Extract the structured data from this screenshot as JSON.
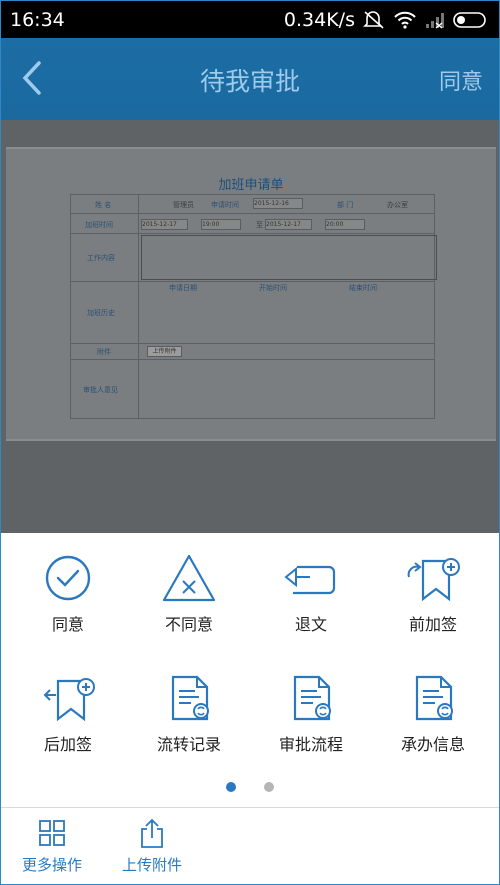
{
  "status": {
    "time": "16:34",
    "speed": "0.34K/s"
  },
  "appbar": {
    "title": "待我审批",
    "right_action": "同意"
  },
  "form": {
    "title": "加班申请单",
    "name_label": "姓 名",
    "name_value": "管理员",
    "apply_time_label": "申请时间",
    "apply_time_value": "2015-12-16",
    "dept_label": "部 门",
    "dept_value": "办公室",
    "overtime_label": "加班时间",
    "start_date": "2015-12-17",
    "start_time": "19:00",
    "to": "至",
    "end_date": "2015-12-17",
    "end_time": "20:00",
    "work_label": "工作内容",
    "history_label": "加班历史",
    "history_headers": [
      "申请日期",
      "开始时间",
      "结束时间"
    ],
    "attach_label": "附件",
    "upload_btn": "上传附件",
    "opinion_label": "审批人意见"
  },
  "actions": [
    {
      "label": "同意",
      "icon": "check-circle-icon"
    },
    {
      "label": "不同意",
      "icon": "triangle-x-icon"
    },
    {
      "label": "退文",
      "icon": "return-arrow-icon"
    },
    {
      "label": "前加签",
      "icon": "flag-add-icon"
    },
    {
      "label": "后加签",
      "icon": "flag-add-back-icon"
    },
    {
      "label": "流转记录",
      "icon": "document-refresh-icon"
    },
    {
      "label": "审批流程",
      "icon": "document-refresh-icon"
    },
    {
      "label": "承办信息",
      "icon": "document-refresh-icon"
    }
  ],
  "pager": {
    "active_index": 0,
    "count": 2
  },
  "bottom": {
    "more_label": "更多操作",
    "upload_label": "上传附件"
  },
  "colors": {
    "accent": "#2a79c0",
    "appbar": "#1c6da4",
    "dot_active": "#2a79c0",
    "dot_inactive": "#b5b5b5"
  }
}
